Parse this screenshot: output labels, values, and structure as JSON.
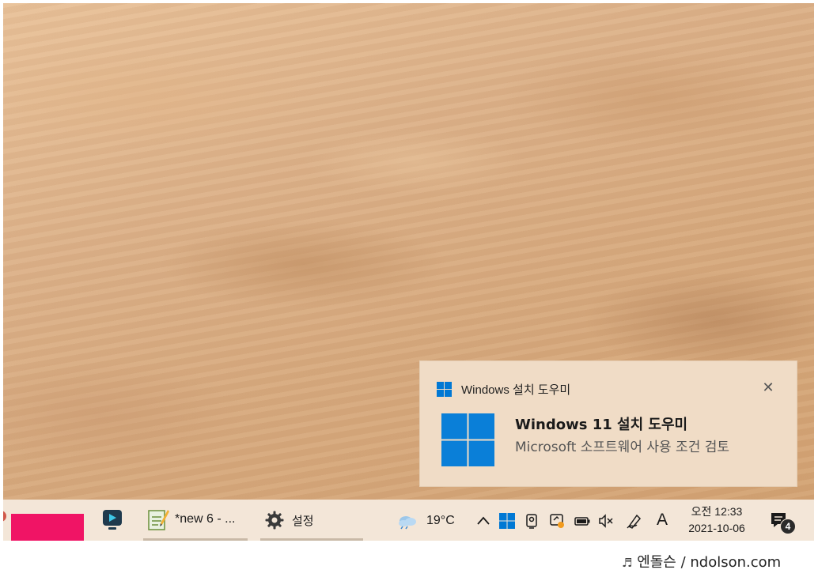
{
  "toast": {
    "app_name": "Windows 설치 도우미",
    "close_glyph": "✕",
    "title": "Windows 11 설치 도우미",
    "message": "Microsoft 소프트웨어 사용 조건 검토"
  },
  "taskbar": {
    "notepad_label": "*new 6 - ...",
    "settings_label": "설정",
    "weather_temp": "19°C",
    "overflow_chevron": "^",
    "language_indicator": "A",
    "clock_period_time": "오전 12:33",
    "clock_date": "2021-10-06",
    "notification_count": "4",
    "accent_color": "#0078d4",
    "red_app_color": "#f01465"
  },
  "watermark": {
    "note_glyph": "♬",
    "text": "엔돌슨 / ndolson.com"
  }
}
